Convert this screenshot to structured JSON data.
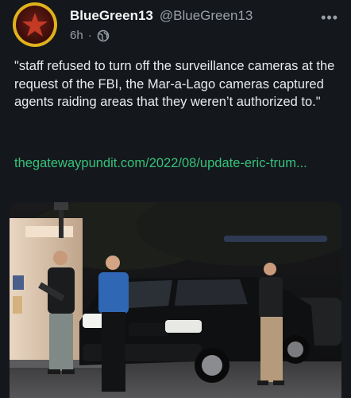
{
  "post": {
    "display_name": "BlueGreen13",
    "handle": "@BlueGreen13",
    "time": "6h",
    "separator": "·",
    "visibility_icon": "globe-icon",
    "more_icon": "more-dots-icon",
    "text": "\"staff refused to turn off the surveillance cameras at the request of the FBI, the Mar-a-Lago cameras captured agents raiding areas that they weren’t authorized to.\"",
    "link_text": "thegatewaypundit.com/2022/08/update-eric-trum..."
  },
  "colors": {
    "background": "#14171c",
    "link": "#37c27a",
    "avatar_ring": "#e0b21c"
  }
}
